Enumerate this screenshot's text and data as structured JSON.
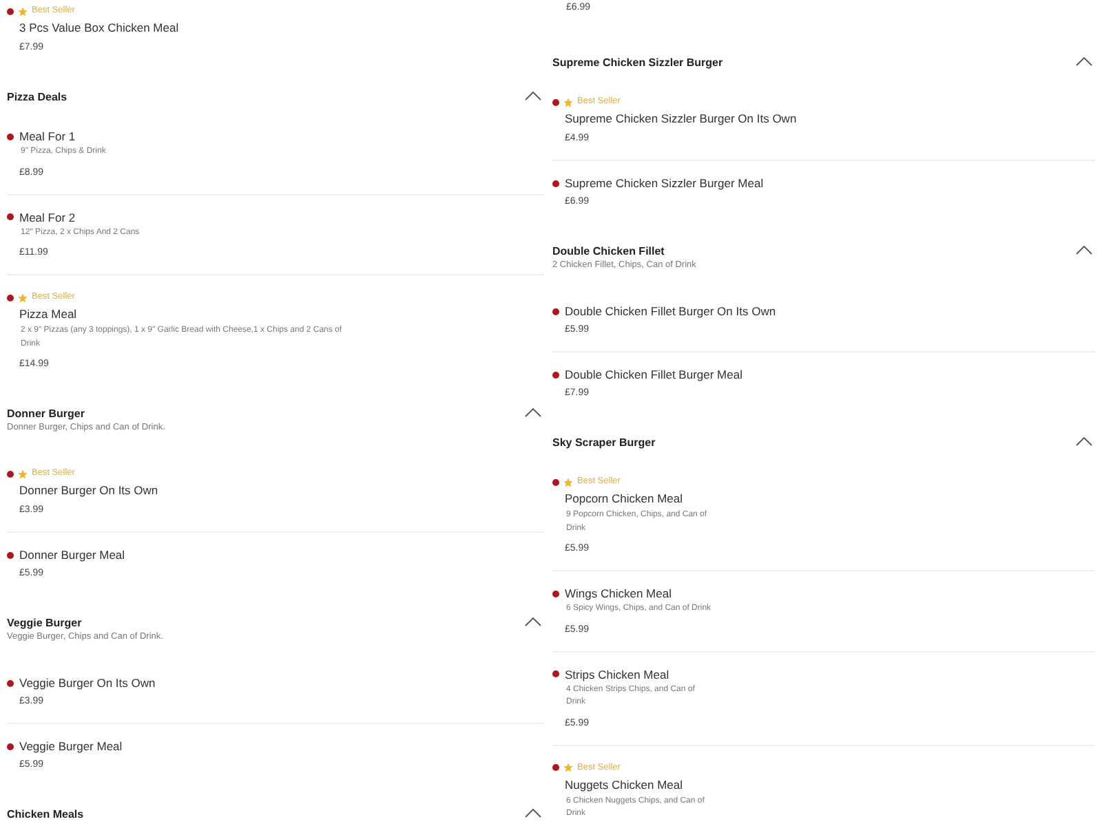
{
  "columns": [
    {
      "entries": [
        {
          "kind": "item",
          "best_seller": true,
          "badge": "Best Seller",
          "name": "3 Pcs Value Box Chicken Meal",
          "price": "£7.99"
        },
        {
          "kind": "section",
          "title": "Pizza Deals",
          "expanded": true
        },
        {
          "kind": "item",
          "best_seller": false,
          "name": "Meal For 1",
          "description": "9\" Pizza, Chips & Drink",
          "price": "£8.99"
        },
        {
          "kind": "item",
          "best_seller": false,
          "name": "Meal For 2",
          "description": "12\" Pizza, 2 x Chips And 2 Cans",
          "price": "£11.99"
        },
        {
          "kind": "item",
          "best_seller": true,
          "badge": "Best Seller",
          "name": "Pizza Meal",
          "description": "2 x 9\" Pizzas (any 3 toppings), 1 x 9\" Garlic Bread with Cheese,1 x Chips and 2 Cans of Drink",
          "price": "£14.99"
        },
        {
          "kind": "section",
          "title": "Donner Burger",
          "subtitle": "Donner Burger, Chips and Can of Drink.",
          "expanded": true
        },
        {
          "kind": "item",
          "best_seller": true,
          "badge": "Best Seller",
          "name": "Donner Burger On Its Own",
          "price": "£3.99"
        },
        {
          "kind": "item",
          "best_seller": false,
          "name": "Donner Burger Meal",
          "price": "£5.99"
        },
        {
          "kind": "section",
          "title": "Veggie Burger",
          "subtitle": "Veggie Burger, Chips and Can of Drink.",
          "expanded": true
        },
        {
          "kind": "item",
          "best_seller": false,
          "name": "Veggie Burger On Its Own",
          "price": "£3.99"
        },
        {
          "kind": "item",
          "best_seller": false,
          "name": "Veggie Burger Meal",
          "price": "£5.99"
        },
        {
          "kind": "section",
          "title": "Chicken Meals",
          "expanded": true
        }
      ]
    },
    {
      "entries": [
        {
          "kind": "price",
          "price": "£6.99"
        },
        {
          "kind": "section",
          "title": "Supreme Chicken Sizzler Burger",
          "expanded": true
        },
        {
          "kind": "item",
          "best_seller": true,
          "badge": "Best Seller",
          "name": "Supreme Chicken Sizzler Burger On Its Own",
          "price": "£4.99"
        },
        {
          "kind": "item",
          "best_seller": false,
          "name": "Supreme Chicken Sizzler Burger Meal",
          "price": "£6.99"
        },
        {
          "kind": "section",
          "title": "Double Chicken Fillet",
          "subtitle": "2 Chicken Fillet, Chips, Can of Drink",
          "expanded": true
        },
        {
          "kind": "item",
          "best_seller": false,
          "name": "Double Chicken Fillet Burger On Its Own",
          "price": "£5.99"
        },
        {
          "kind": "item",
          "best_seller": false,
          "name": "Double Chicken Fillet Burger Meal",
          "price": "£7.99"
        },
        {
          "kind": "section",
          "title": "Sky Scraper Burger",
          "expanded": true
        },
        {
          "kind": "item",
          "best_seller": true,
          "badge": "Best Seller",
          "name": "Popcorn Chicken Meal",
          "description": "9 Popcorn Chicken, Chips, and Can of Drink",
          "price": "£5.99"
        },
        {
          "kind": "item",
          "best_seller": false,
          "name": "Wings Chicken Meal",
          "description": "6 Spicy Wings, Chips, and Can of Drink",
          "price": "£5.99"
        },
        {
          "kind": "item",
          "best_seller": false,
          "name": "Strips Chicken Meal",
          "description": "4 Chicken Strips Chips, and Can of Drink",
          "price": "£5.99"
        },
        {
          "kind": "item",
          "best_seller": true,
          "badge": "Best Seller",
          "name": "Nuggets Chicken Meal",
          "description": "6 Chicken Nuggets Chips, and Can of Drink"
        }
      ]
    }
  ]
}
